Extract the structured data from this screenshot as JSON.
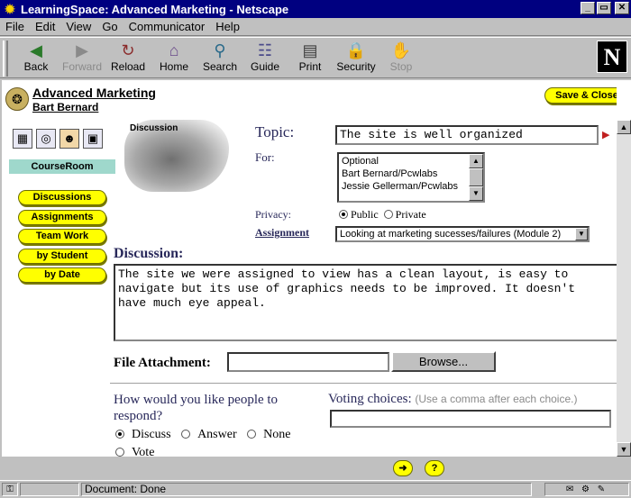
{
  "window": {
    "title": "LearningSpace: Advanced Marketing - Netscape",
    "min_glyph": "_",
    "max_glyph": "▭",
    "close_glyph": "✕"
  },
  "menu": [
    "File",
    "Edit",
    "View",
    "Go",
    "Communicator",
    "Help"
  ],
  "toolbar": [
    {
      "label": "Back",
      "icon": "back-arrow-icon",
      "glyph": "◀",
      "enabled": true
    },
    {
      "label": "Forward",
      "icon": "forward-arrow-icon",
      "glyph": "▶",
      "enabled": false
    },
    {
      "label": "Reload",
      "icon": "reload-icon",
      "glyph": "↻",
      "enabled": true
    },
    {
      "label": "Home",
      "icon": "home-icon",
      "glyph": "⌂",
      "enabled": true
    },
    {
      "label": "Search",
      "icon": "search-icon",
      "glyph": "⚲",
      "enabled": true
    },
    {
      "label": "Guide",
      "icon": "guide-icon",
      "glyph": "☷",
      "enabled": true
    },
    {
      "label": "Print",
      "icon": "print-icon",
      "glyph": "▤",
      "enabled": true
    },
    {
      "label": "Security",
      "icon": "lock-icon",
      "glyph": "🔒",
      "enabled": true
    },
    {
      "label": "Stop",
      "icon": "stop-icon",
      "glyph": "✋",
      "enabled": false
    }
  ],
  "brand": {
    "logo_letter": "N"
  },
  "course": {
    "title": "Advanced Marketing",
    "user": "Bart Bernard",
    "save_close": "Save & Close"
  },
  "sidebar": {
    "section": "CourseRoom",
    "icons": [
      "calendar-icon",
      "database-icon",
      "people-icon",
      "profile-icon"
    ],
    "items": [
      "Discussions",
      "Assignments",
      "Team Work",
      "by Student",
      "by Date"
    ]
  },
  "photo_label": "Discussion",
  "form": {
    "topic_label": "Topic:",
    "topic_value": "The site is well organized",
    "for_label": "For:",
    "for_options": [
      "Optional",
      "Bart Bernard/Pcwlabs",
      "Jessie Gellerman/Pcwlabs"
    ],
    "privacy_label": "Privacy:",
    "privacy_public": "Public",
    "privacy_private": "Private",
    "privacy_selected": "Public",
    "assignment_label": "Assignment",
    "assignment_value": "Looking at marketing sucesses/failures (Module 2)",
    "discussion_label": "Discussion:",
    "discussion_text": "The site we were assigned to view has a clean layout, is easy to\nnavigate but its use of graphics needs to be improved. It doesn't\nhave much eye appeal.",
    "file_label": "File Attachment:",
    "browse_label": "Browse...",
    "respond_question": "How would you like people to respond?",
    "respond_options": [
      "Discuss",
      "Answer",
      "None",
      "Vote"
    ],
    "respond_selected": "Discuss",
    "voting_label": "Voting choices:",
    "voting_hint": "(Use a comma after each choice.)"
  },
  "bottom_buttons": [
    {
      "name": "go-icon",
      "glyph": "➜"
    },
    {
      "name": "help-icon",
      "glyph": "?"
    }
  ],
  "status": {
    "text": "Document: Done",
    "tray": "✉ ⚙ ✎"
  },
  "colors": {
    "titlebar": "#000080",
    "nav_pill": "#ffff00",
    "courseroom": "#9fd8cc",
    "label_navy": "#28285a"
  }
}
